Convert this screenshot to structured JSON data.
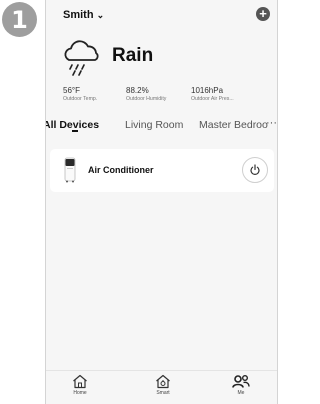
{
  "step": "1",
  "header": {
    "home_name": "Smith",
    "chevron": "⌄",
    "add_symbol": "+"
  },
  "weather": {
    "icon": "rain-cloud-icon",
    "condition": "Rain",
    "stats": [
      {
        "value": "56°F",
        "label": "Outdoor Temp."
      },
      {
        "value": "88.2%",
        "label": "Outdoor Humidity"
      },
      {
        "value": "1016hPa",
        "label": "Outdoor Air Pres..."
      }
    ]
  },
  "tabs": [
    {
      "label": "All Devices",
      "active": true
    },
    {
      "label": "Living Room",
      "active": false
    },
    {
      "label": "Master Bedroo",
      "active": false
    }
  ],
  "more": "···",
  "devices": [
    {
      "name": "Air Conditioner",
      "icon": "air-conditioner-icon",
      "power_icon": "power-icon"
    }
  ],
  "nav": [
    {
      "label": "Home",
      "icon": "home-icon"
    },
    {
      "label": "Smart",
      "icon": "smart-home-icon"
    },
    {
      "label": "Me",
      "icon": "me-icon"
    }
  ]
}
